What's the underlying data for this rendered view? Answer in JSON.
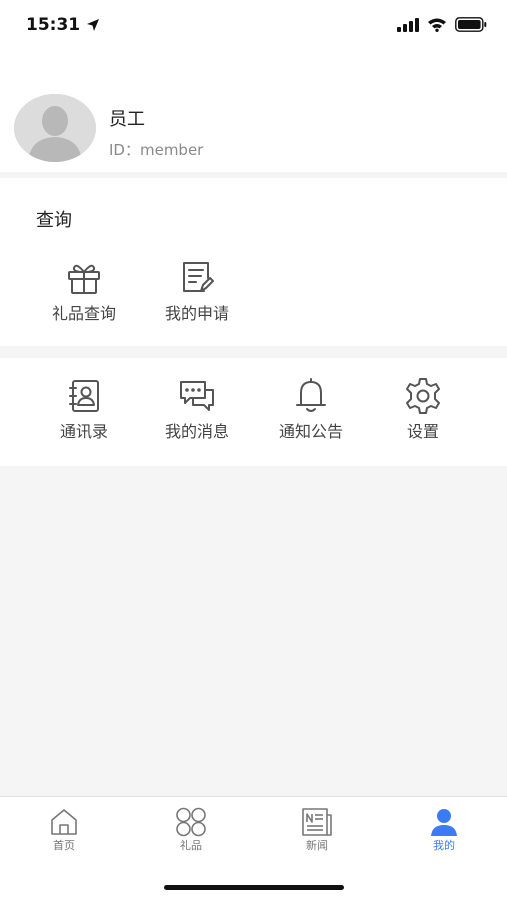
{
  "status_bar": {
    "time": "15:31"
  },
  "profile": {
    "name": "员工",
    "id_text": "ID：member"
  },
  "query_section": {
    "title": "查询",
    "items": [
      {
        "label": "礼品查询",
        "icon": "gift-icon"
      },
      {
        "label": "我的申请",
        "icon": "application-form-icon"
      }
    ]
  },
  "tools_section": {
    "items": [
      {
        "label": "通讯录",
        "icon": "contacts-book-icon"
      },
      {
        "label": "我的消息",
        "icon": "chat-bubbles-icon"
      },
      {
        "label": "通知公告",
        "icon": "bell-icon"
      },
      {
        "label": "设置",
        "icon": "gear-icon"
      }
    ]
  },
  "tab_bar": {
    "tabs": [
      {
        "label": "首页",
        "icon": "home-icon",
        "active": false
      },
      {
        "label": "礼品",
        "icon": "four-circles-icon",
        "active": false
      },
      {
        "label": "新闻",
        "icon": "newspaper-icon",
        "active": false
      },
      {
        "label": "我的",
        "icon": "person-icon",
        "active": true
      }
    ]
  },
  "colors": {
    "accent": "#3b7cf5",
    "background": "#f5f5f5"
  }
}
